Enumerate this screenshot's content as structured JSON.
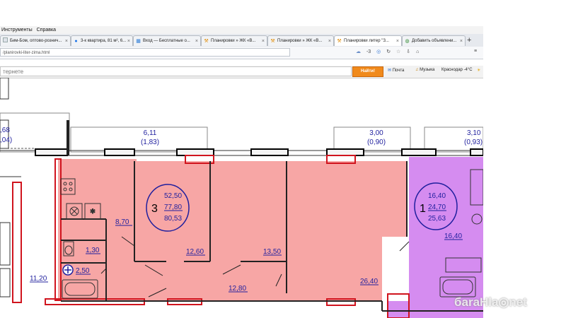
{
  "browser": {
    "menu": [
      "Инструменты",
      "Справка"
    ],
    "tabs": [
      {
        "label": "Бим-Бом, оптово-рознич...",
        "icon": "page-icon",
        "active": false
      },
      {
        "label": "3-к квартира, 81 м², 6...",
        "icon": "avito-icon",
        "active": false
      },
      {
        "label": "Вход — Бесплатные о...",
        "icon": "windows-icon",
        "active": false
      },
      {
        "label": "Планировки » ЖК «В...",
        "icon": "crane-icon",
        "active": false
      },
      {
        "label": "Планировки » ЖК «В...",
        "icon": "crane-icon",
        "active": false
      },
      {
        "label": "Планировки литер \"З...",
        "icon": "crane-icon",
        "active": true
      },
      {
        "label": "Добавить объявлени...",
        "icon": "earth-icon",
        "active": false
      }
    ],
    "new_tab": "+",
    "url": "/planirovki-liter-zima.html",
    "toolbar_counter": "-3",
    "search": {
      "placeholder": "тернете",
      "button": "Найти!",
      "mail": "Почта",
      "music": "Музыка",
      "weather": "Краснодар -4°C"
    }
  },
  "plan": {
    "balcony_labels": [
      {
        "area": "6,11",
        "sub": "(1,83)"
      },
      {
        "area": "3,00",
        "sub": "(0,90)"
      },
      {
        "area": "3,10",
        "sub": "(0,93)"
      },
      {
        "area": ",68",
        "sub": ",04)"
      }
    ],
    "apartment_3": {
      "rooms": "3",
      "living": "52,50",
      "total": "77,80",
      "with_balcony": "80,53"
    },
    "apartment_1": {
      "rooms": "1",
      "living": "16,40",
      "total": "24,70",
      "with_balcony": "25,63"
    },
    "room_areas": {
      "hall": "8,70",
      "wc": "1,30",
      "bath": "2,50",
      "room_left": "12,60",
      "room_mid": "13,50",
      "corridor": "12,80",
      "kitchen": "26,40",
      "room_1": "16,40",
      "neighbor": "11,20"
    },
    "colors": {
      "apartment_3": "#f7a6a5",
      "apartment_1": "#d58cf0",
      "label": "#1f1f9e",
      "column": "#d0141e"
    }
  },
  "watermark": "бaraHla◎net"
}
